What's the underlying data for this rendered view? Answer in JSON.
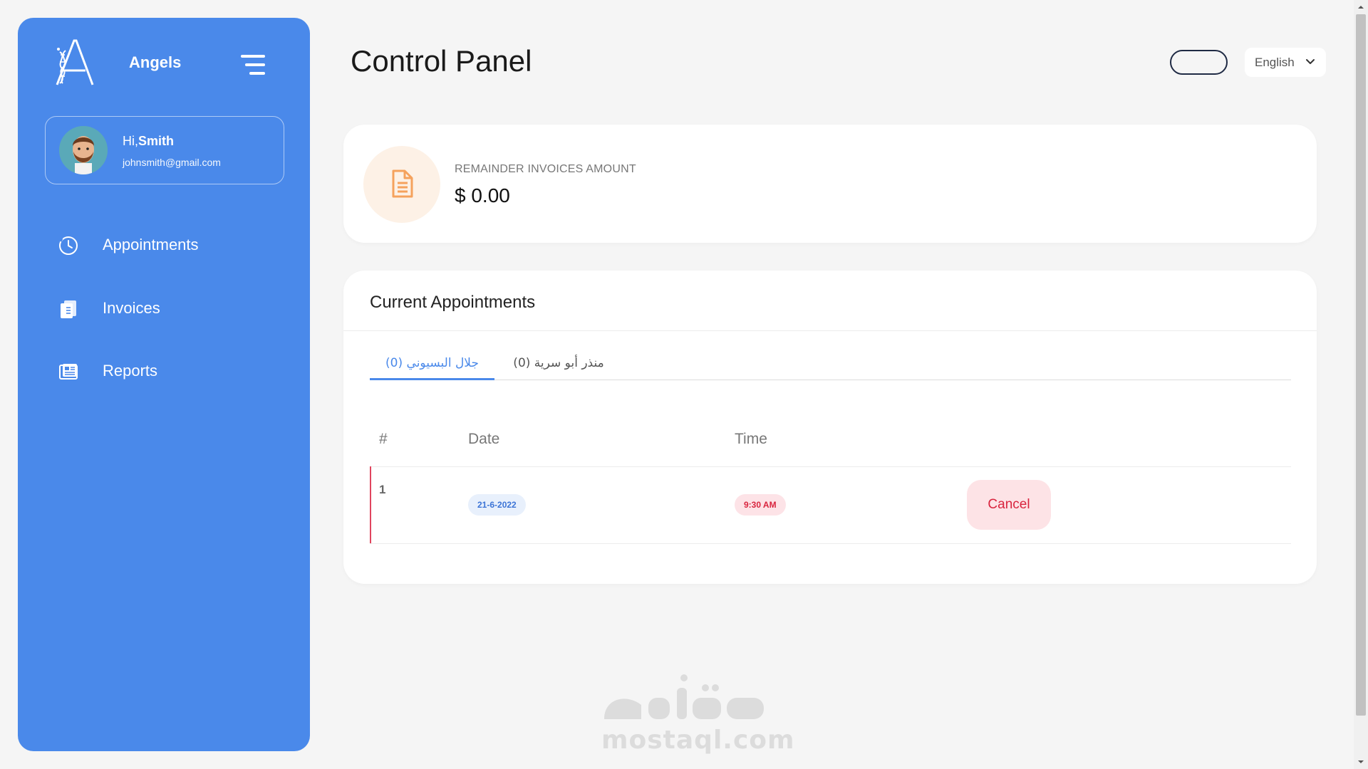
{
  "sidebar": {
    "brand": {
      "name": "Angels",
      "logo_icon": "angels-dna-logo"
    },
    "menu_icon": "hamburger-menu-icon",
    "user": {
      "greeting": "Hi,",
      "name": "Smith",
      "email": "johnsmith@gmail.com"
    },
    "items": [
      {
        "label": "Appointments",
        "icon": "clock-icon"
      },
      {
        "label": "Invoices",
        "icon": "invoice-icon"
      },
      {
        "label": "Reports",
        "icon": "reports-icon"
      }
    ]
  },
  "header": {
    "title": "Control Panel",
    "language": {
      "selected": "English"
    }
  },
  "summary": {
    "label": "REMAINDER INVOICES AMOUNT",
    "value": "$ 0.00",
    "icon": "document-icon"
  },
  "appointments": {
    "title": "Current Appointments",
    "tabs": [
      {
        "label": "جلال البسيوني (0)",
        "active": true
      },
      {
        "label": "منذر أبو سرية (0)",
        "active": false
      }
    ],
    "columns": [
      "#",
      "Date",
      "Time"
    ],
    "rows": [
      {
        "num": "1",
        "date": "21-6-2022",
        "time": "9:30 AM",
        "action": "Cancel"
      }
    ]
  },
  "watermark": {
    "text": "mostaql.com"
  },
  "colors": {
    "primary": "#4a89ea",
    "background": "#f5f5f5",
    "danger": "#d9243e",
    "danger_bg": "#fde3e6",
    "invoice_icon": "#f5a25d"
  }
}
